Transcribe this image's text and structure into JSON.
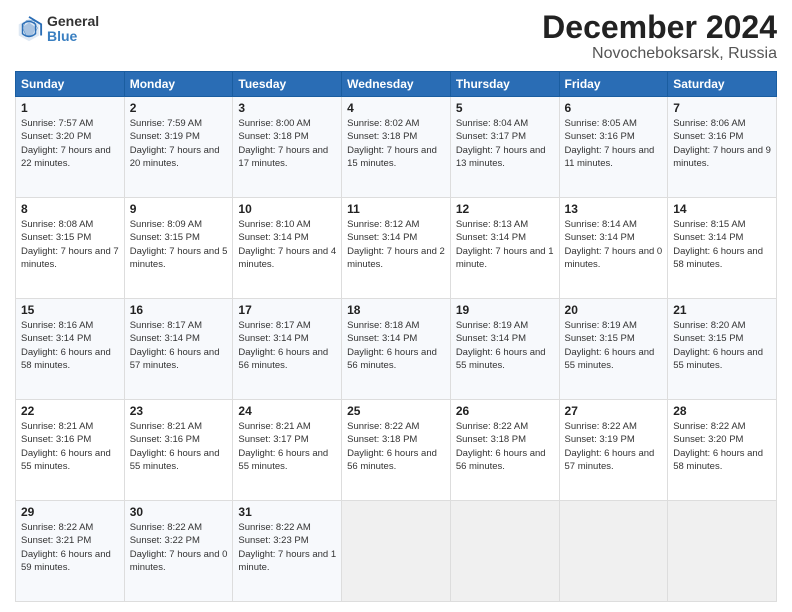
{
  "logo": {
    "general": "General",
    "blue": "Blue"
  },
  "title": {
    "month": "December 2024",
    "location": "Novocheboksarsk, Russia"
  },
  "weekdays": [
    "Sunday",
    "Monday",
    "Tuesday",
    "Wednesday",
    "Thursday",
    "Friday",
    "Saturday"
  ],
  "weeks": [
    [
      {
        "day": "1",
        "sunrise": "Sunrise: 7:57 AM",
        "sunset": "Sunset: 3:20 PM",
        "daylight": "Daylight: 7 hours and 22 minutes."
      },
      {
        "day": "2",
        "sunrise": "Sunrise: 7:59 AM",
        "sunset": "Sunset: 3:19 PM",
        "daylight": "Daylight: 7 hours and 20 minutes."
      },
      {
        "day": "3",
        "sunrise": "Sunrise: 8:00 AM",
        "sunset": "Sunset: 3:18 PM",
        "daylight": "Daylight: 7 hours and 17 minutes."
      },
      {
        "day": "4",
        "sunrise": "Sunrise: 8:02 AM",
        "sunset": "Sunset: 3:18 PM",
        "daylight": "Daylight: 7 hours and 15 minutes."
      },
      {
        "day": "5",
        "sunrise": "Sunrise: 8:04 AM",
        "sunset": "Sunset: 3:17 PM",
        "daylight": "Daylight: 7 hours and 13 minutes."
      },
      {
        "day": "6",
        "sunrise": "Sunrise: 8:05 AM",
        "sunset": "Sunset: 3:16 PM",
        "daylight": "Daylight: 7 hours and 11 minutes."
      },
      {
        "day": "7",
        "sunrise": "Sunrise: 8:06 AM",
        "sunset": "Sunset: 3:16 PM",
        "daylight": "Daylight: 7 hours and 9 minutes."
      }
    ],
    [
      {
        "day": "8",
        "sunrise": "Sunrise: 8:08 AM",
        "sunset": "Sunset: 3:15 PM",
        "daylight": "Daylight: 7 hours and 7 minutes."
      },
      {
        "day": "9",
        "sunrise": "Sunrise: 8:09 AM",
        "sunset": "Sunset: 3:15 PM",
        "daylight": "Daylight: 7 hours and 5 minutes."
      },
      {
        "day": "10",
        "sunrise": "Sunrise: 8:10 AM",
        "sunset": "Sunset: 3:14 PM",
        "daylight": "Daylight: 7 hours and 4 minutes."
      },
      {
        "day": "11",
        "sunrise": "Sunrise: 8:12 AM",
        "sunset": "Sunset: 3:14 PM",
        "daylight": "Daylight: 7 hours and 2 minutes."
      },
      {
        "day": "12",
        "sunrise": "Sunrise: 8:13 AM",
        "sunset": "Sunset: 3:14 PM",
        "daylight": "Daylight: 7 hours and 1 minute."
      },
      {
        "day": "13",
        "sunrise": "Sunrise: 8:14 AM",
        "sunset": "Sunset: 3:14 PM",
        "daylight": "Daylight: 7 hours and 0 minutes."
      },
      {
        "day": "14",
        "sunrise": "Sunrise: 8:15 AM",
        "sunset": "Sunset: 3:14 PM",
        "daylight": "Daylight: 6 hours and 58 minutes."
      }
    ],
    [
      {
        "day": "15",
        "sunrise": "Sunrise: 8:16 AM",
        "sunset": "Sunset: 3:14 PM",
        "daylight": "Daylight: 6 hours and 58 minutes."
      },
      {
        "day": "16",
        "sunrise": "Sunrise: 8:17 AM",
        "sunset": "Sunset: 3:14 PM",
        "daylight": "Daylight: 6 hours and 57 minutes."
      },
      {
        "day": "17",
        "sunrise": "Sunrise: 8:17 AM",
        "sunset": "Sunset: 3:14 PM",
        "daylight": "Daylight: 6 hours and 56 minutes."
      },
      {
        "day": "18",
        "sunrise": "Sunrise: 8:18 AM",
        "sunset": "Sunset: 3:14 PM",
        "daylight": "Daylight: 6 hours and 56 minutes."
      },
      {
        "day": "19",
        "sunrise": "Sunrise: 8:19 AM",
        "sunset": "Sunset: 3:14 PM",
        "daylight": "Daylight: 6 hours and 55 minutes."
      },
      {
        "day": "20",
        "sunrise": "Sunrise: 8:19 AM",
        "sunset": "Sunset: 3:15 PM",
        "daylight": "Daylight: 6 hours and 55 minutes."
      },
      {
        "day": "21",
        "sunrise": "Sunrise: 8:20 AM",
        "sunset": "Sunset: 3:15 PM",
        "daylight": "Daylight: 6 hours and 55 minutes."
      }
    ],
    [
      {
        "day": "22",
        "sunrise": "Sunrise: 8:21 AM",
        "sunset": "Sunset: 3:16 PM",
        "daylight": "Daylight: 6 hours and 55 minutes."
      },
      {
        "day": "23",
        "sunrise": "Sunrise: 8:21 AM",
        "sunset": "Sunset: 3:16 PM",
        "daylight": "Daylight: 6 hours and 55 minutes."
      },
      {
        "day": "24",
        "sunrise": "Sunrise: 8:21 AM",
        "sunset": "Sunset: 3:17 PM",
        "daylight": "Daylight: 6 hours and 55 minutes."
      },
      {
        "day": "25",
        "sunrise": "Sunrise: 8:22 AM",
        "sunset": "Sunset: 3:18 PM",
        "daylight": "Daylight: 6 hours and 56 minutes."
      },
      {
        "day": "26",
        "sunrise": "Sunrise: 8:22 AM",
        "sunset": "Sunset: 3:18 PM",
        "daylight": "Daylight: 6 hours and 56 minutes."
      },
      {
        "day": "27",
        "sunrise": "Sunrise: 8:22 AM",
        "sunset": "Sunset: 3:19 PM",
        "daylight": "Daylight: 6 hours and 57 minutes."
      },
      {
        "day": "28",
        "sunrise": "Sunrise: 8:22 AM",
        "sunset": "Sunset: 3:20 PM",
        "daylight": "Daylight: 6 hours and 58 minutes."
      }
    ],
    [
      {
        "day": "29",
        "sunrise": "Sunrise: 8:22 AM",
        "sunset": "Sunset: 3:21 PM",
        "daylight": "Daylight: 6 hours and 59 minutes."
      },
      {
        "day": "30",
        "sunrise": "Sunrise: 8:22 AM",
        "sunset": "Sunset: 3:22 PM",
        "daylight": "Daylight: 7 hours and 0 minutes."
      },
      {
        "day": "31",
        "sunrise": "Sunrise: 8:22 AM",
        "sunset": "Sunset: 3:23 PM",
        "daylight": "Daylight: 7 hours and 1 minute."
      },
      null,
      null,
      null,
      null
    ]
  ]
}
